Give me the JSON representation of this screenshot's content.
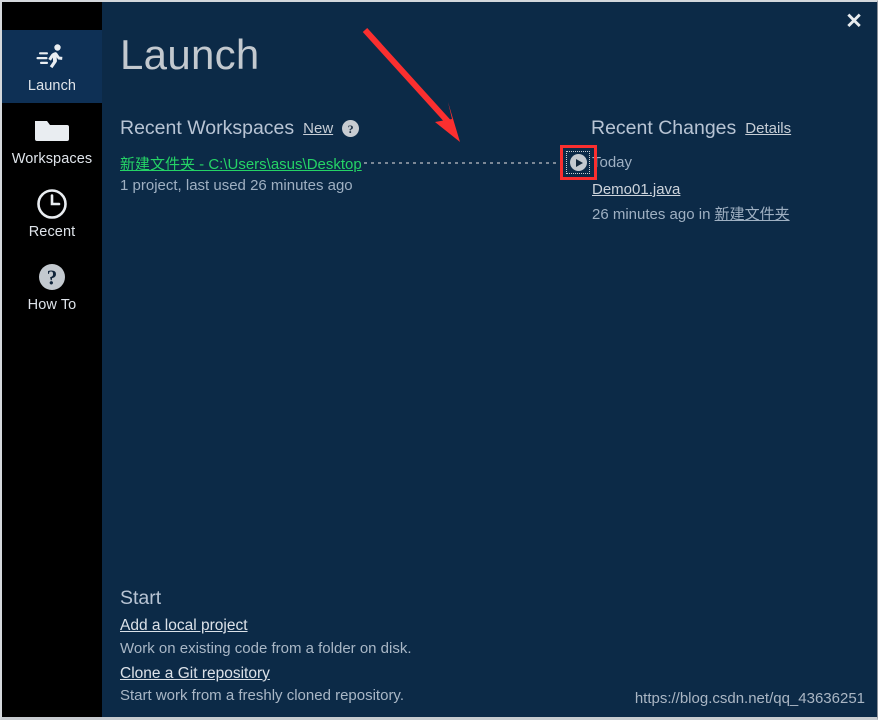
{
  "window": {
    "title": "Launch",
    "close_label": "✕",
    "bg_color": "#0c2a47",
    "sidebar_bg_color": "#000000",
    "sidebar_selected_color": "#0e3055",
    "accent_link_color": "#25d366",
    "annotation_color": "#fb2f2f"
  },
  "sidebar": {
    "items": [
      {
        "label": "Launch",
        "icon": "runner-icon",
        "selected": true
      },
      {
        "label": "Workspaces",
        "icon": "folder-icon",
        "selected": false
      },
      {
        "label": "Recent",
        "icon": "clock-icon",
        "selected": false
      },
      {
        "label": "How To",
        "icon": "question-mark-icon",
        "selected": false
      }
    ]
  },
  "recent_workspaces": {
    "heading": "Recent Workspaces",
    "new_link": "New",
    "help_icon_label": "?",
    "entry": {
      "path": "新建文件夹 - C:\\Users\\asus\\Desktop",
      "meta": "1 project, last used 26 minutes ago",
      "launch_button_icon": "play-icon"
    }
  },
  "recent_changes": {
    "heading": "Recent Changes",
    "details_link": "Details",
    "group_label": "Today",
    "file_name": "Demo01.java",
    "file_meta_prefix": "26 minutes ago in ",
    "file_meta_location": "新建文件夹"
  },
  "start": {
    "heading": "Start",
    "actions": [
      {
        "link": "Add a local project",
        "description": "Work on existing code from a folder on disk."
      },
      {
        "link": "Clone a Git repository",
        "description": "Start work from a freshly cloned repository."
      }
    ]
  },
  "watermark": {
    "text": "https://blog.csdn.net/qq_43636251"
  }
}
